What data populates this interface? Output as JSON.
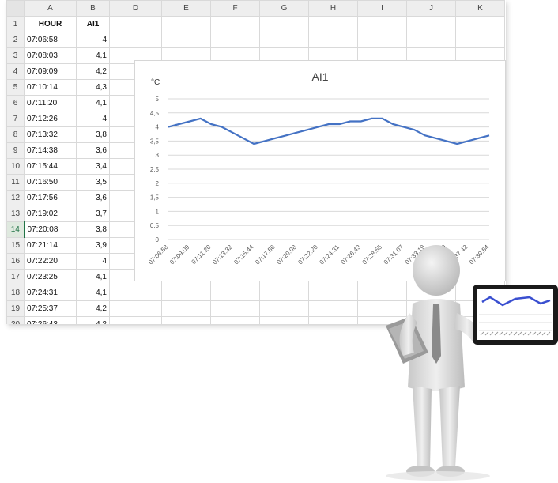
{
  "sheet": {
    "columns": [
      "A",
      "B",
      "D",
      "E",
      "F",
      "G",
      "H",
      "I",
      "J",
      "K"
    ],
    "header_row": {
      "num": "1",
      "a": "HOUR",
      "b": "AI1"
    },
    "rows": [
      {
        "num": "2",
        "a": "07:06:58",
        "b": "4"
      },
      {
        "num": "3",
        "a": "07:08:03",
        "b": "4,1"
      },
      {
        "num": "4",
        "a": "07:09:09",
        "b": "4,2"
      },
      {
        "num": "5",
        "a": "07:10:14",
        "b": "4,3"
      },
      {
        "num": "6",
        "a": "07:11:20",
        "b": "4,1"
      },
      {
        "num": "7",
        "a": "07:12:26",
        "b": "4"
      },
      {
        "num": "8",
        "a": "07:13:32",
        "b": "3,8"
      },
      {
        "num": "9",
        "a": "07:14:38",
        "b": "3,6"
      },
      {
        "num": "10",
        "a": "07:15:44",
        "b": "3,4"
      },
      {
        "num": "11",
        "a": "07:16:50",
        "b": "3,5"
      },
      {
        "num": "12",
        "a": "07:17:56",
        "b": "3,6"
      },
      {
        "num": "13",
        "a": "07:19:02",
        "b": "3,7"
      },
      {
        "num": "14",
        "a": "07:20:08",
        "b": "3,8"
      },
      {
        "num": "15",
        "a": "07:21:14",
        "b": "3,9"
      },
      {
        "num": "16",
        "a": "07:22:20",
        "b": "4"
      },
      {
        "num": "17",
        "a": "07:23:25",
        "b": "4,1"
      },
      {
        "num": "18",
        "a": "07:24:31",
        "b": "4,1"
      },
      {
        "num": "19",
        "a": "07:25:37",
        "b": "4,2"
      },
      {
        "num": "20",
        "a": "07:26:43",
        "b": "4,2"
      }
    ],
    "active_row": "14",
    "accent_color": "#217346"
  },
  "chart_data": {
    "type": "line",
    "title": "AI1",
    "ylabel": "°C",
    "ylim": [
      0,
      5
    ],
    "yticks": [
      "0",
      "0,5",
      "1",
      "1,5",
      "2",
      "2,5",
      "3",
      "3,5",
      "4",
      "4,5",
      "5"
    ],
    "xtick_labels": [
      "07:06:58",
      "07:09:09",
      "07:11:20",
      "07:13:32",
      "07:15:44",
      "07:17:56",
      "07:20:08",
      "07:22:20",
      "07:24:31",
      "07:26:43",
      "07:28:55",
      "07:31:07",
      "07:33:19",
      "07:35:30",
      "07:37:42",
      "07:39:54"
    ],
    "x": [
      "07:06:58",
      "07:08:03",
      "07:09:09",
      "07:10:14",
      "07:11:20",
      "07:12:26",
      "07:13:32",
      "07:14:38",
      "07:15:44",
      "07:16:50",
      "07:17:56",
      "07:19:02",
      "07:20:08",
      "07:21:14",
      "07:22:20",
      "07:23:25",
      "07:24:31",
      "07:25:37",
      "07:26:43",
      "07:27:49",
      "07:28:55",
      "07:30:01",
      "07:31:07",
      "07:32:13",
      "07:33:19",
      "07:34:25",
      "07:35:30",
      "07:36:36",
      "07:37:42",
      "07:38:48",
      "07:39:54"
    ],
    "series": [
      {
        "name": "AI1",
        "color": "#4472c4",
        "values": [
          4,
          4.1,
          4.2,
          4.3,
          4.1,
          4,
          3.8,
          3.6,
          3.4,
          3.5,
          3.6,
          3.7,
          3.8,
          3.9,
          4,
          4.1,
          4.1,
          4.2,
          4.2,
          4.3,
          4.3,
          4.1,
          4.0,
          3.9,
          3.7,
          3.6,
          3.5,
          3.4,
          3.5,
          3.6,
          3.7
        ]
      }
    ],
    "grid": true,
    "legend": false
  },
  "figure": {
    "tablet_line_color": "#3a4fd0"
  }
}
